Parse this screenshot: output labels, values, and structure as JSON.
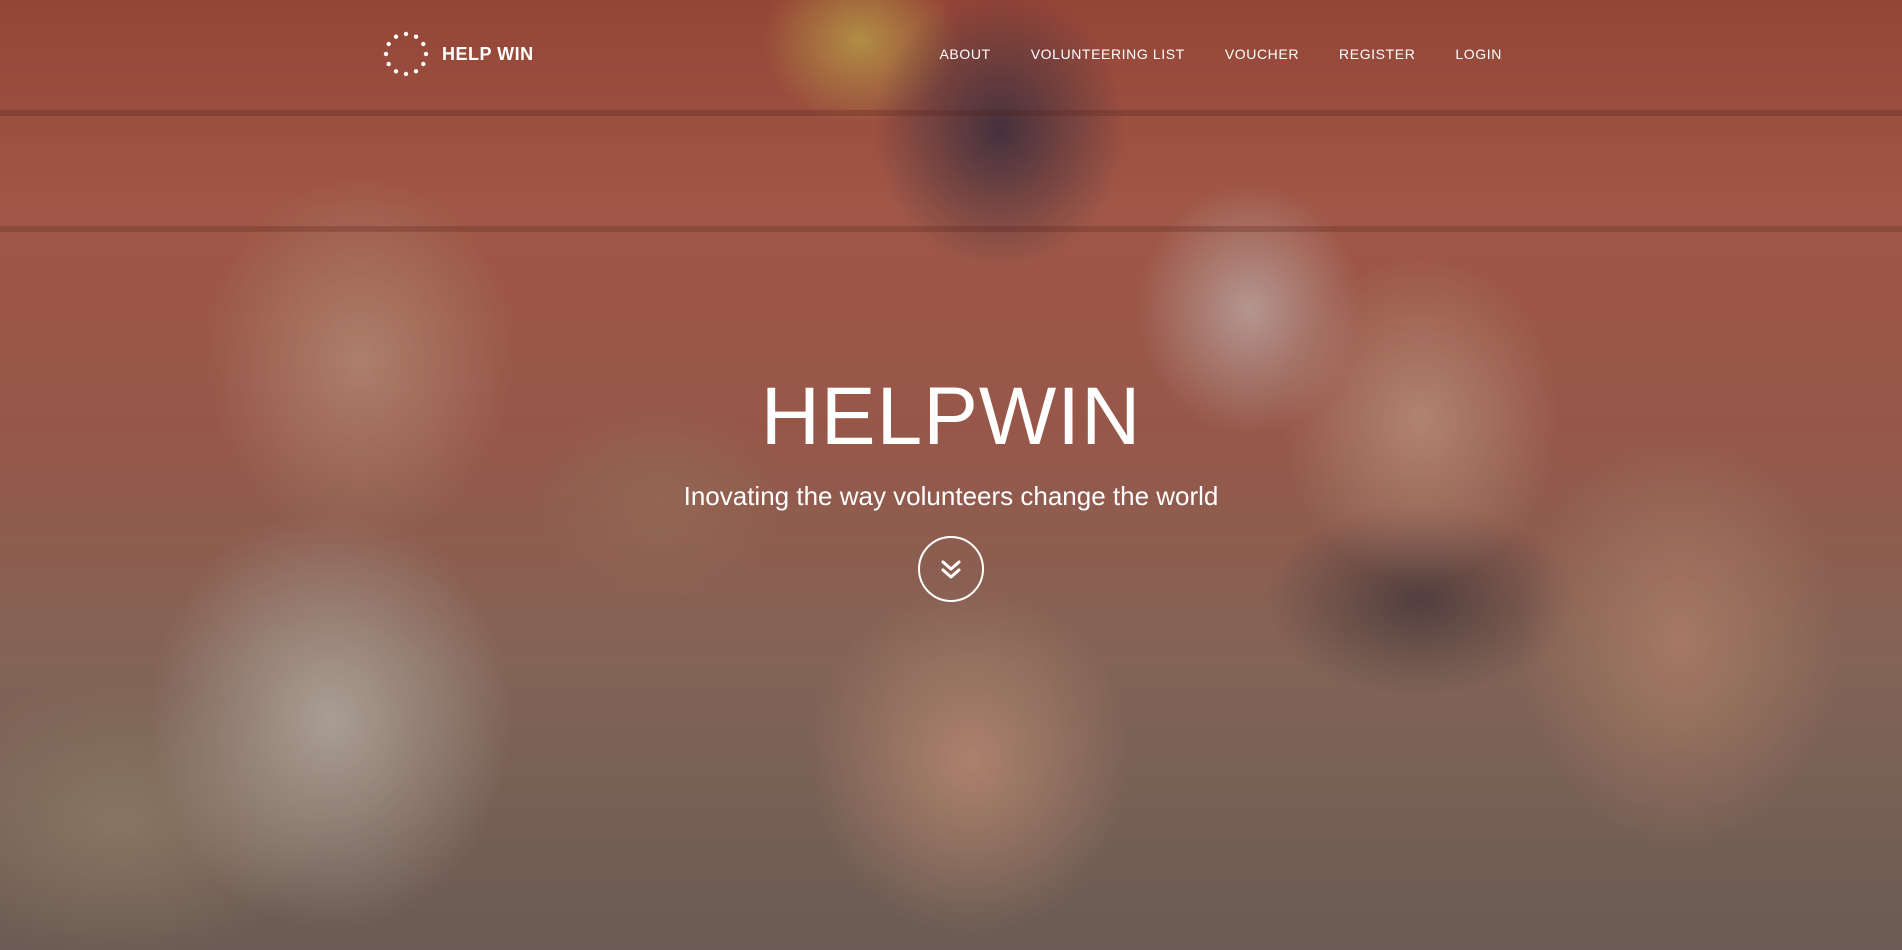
{
  "brand": {
    "name": "HELP WIN",
    "logo_icon": "dotted-circle-logo"
  },
  "nav": {
    "items": [
      {
        "label": "ABOUT"
      },
      {
        "label": "VOLUNTEERING LIST"
      },
      {
        "label": "VOUCHER"
      },
      {
        "label": "REGISTER"
      },
      {
        "label": "LOGIN"
      }
    ]
  },
  "hero": {
    "title": "HELPWIN",
    "subtitle": "Inovating the way volunteers change the world",
    "scroll_icon": "double-chevron-down-icon",
    "background_image": "photo of smiling children waving at camera"
  },
  "colors": {
    "text": "#ffffff",
    "overlay": "#1e191e"
  }
}
